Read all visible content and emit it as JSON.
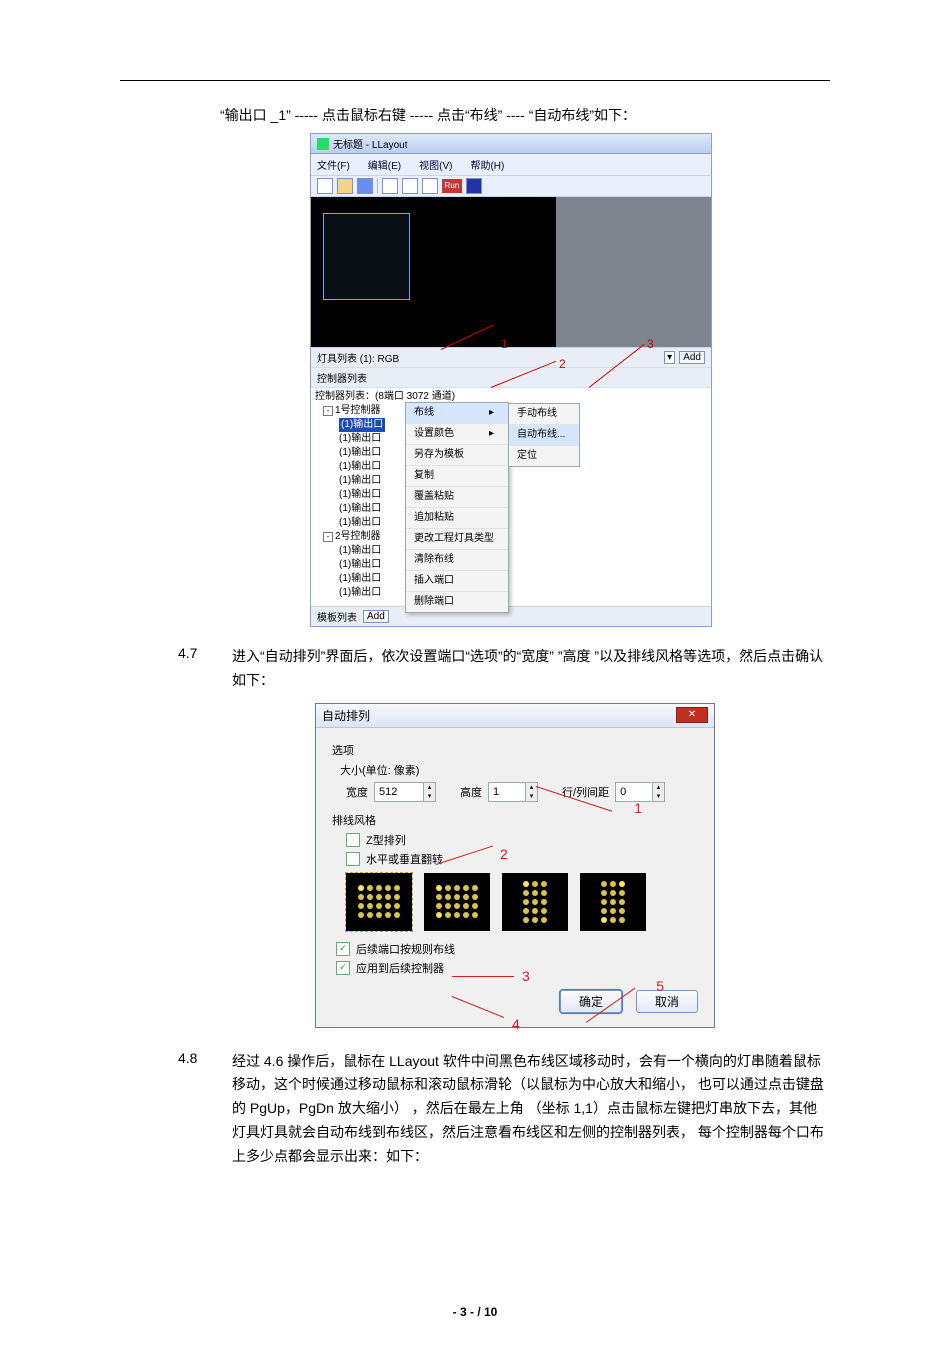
{
  "intro_line": "“输出口 _1” ----- 点击鼠标右键  -----  点击“布线”   ----  “自动布线”如下：",
  "shot1": {
    "title": "无标题 - LLayout",
    "menu": [
      "文件(F)",
      "编辑(E)",
      "视图(V)",
      "帮助(H)"
    ],
    "toolbar_run": "Run",
    "lamp_list_label": "灯具列表 (1): RGB",
    "add": "Add",
    "controller_list_label": "控制器列表",
    "tree_header": "控制器列表：(8端口 3072 通道)",
    "ctrl1": "1号控制器",
    "ctrl2": "2号控制器",
    "ports": [
      "(1)输出口",
      "(1)输出口",
      "(1)输出口",
      "(1)输出口",
      "(1)输出口",
      "(1)输出口",
      "(1)输出口",
      "(1)输出口"
    ],
    "ports2": [
      "(1)输出口",
      "(1)输出口",
      "(1)输出口",
      "(1)输出口"
    ],
    "template_list": "模板列表",
    "ctx_items": [
      "布线",
      "设置颜色",
      "另存为模板",
      "复制",
      "覆盖粘贴",
      "追加粘贴",
      "更改工程灯具类型",
      "清除布线",
      "插入端口",
      "删除端口"
    ],
    "ctx_sub": [
      "手动布线",
      "自动布线...",
      "定位"
    ],
    "marks": {
      "m1": "1",
      "m2": "2",
      "m3": "3"
    }
  },
  "sec47_no": "4.7",
  "sec47_body": "进入“自动排列”界面后，依次设置端口“选项”的“宽度”      ”高度 ”以及排线风格等选项，然后点击确认如下：",
  "shot2": {
    "title": "自动排列",
    "opt_label": "选项",
    "size_label": "大小(单位: 像素)",
    "width_label": "宽度",
    "width_value": "512",
    "height_label": "高度",
    "height_value": "1",
    "gap_label": "行/列间距",
    "gap_value": "0",
    "style_label": "排线风格",
    "chk_z": "Z型排列",
    "chk_hv": "水平或垂直翻转",
    "chk_follow_port": "后续端口按规则布线",
    "chk_apply_ctrl": "应用到后续控制器",
    "ok": "确定",
    "cancel": "取消",
    "marks": {
      "m1": "1",
      "m2": "2",
      "m3": "3",
      "m4": "4",
      "m5": "5"
    }
  },
  "sec48_no": "4.8",
  "sec48_body": "经过 4.6 操作后，鼠标在   LLayout  软件中间黑色布线区域移动时，会有一个横向的灯串随着鼠标移动，这个时候通过移动鼠标和滚动鼠标滑轮（以鼠标为中心放大和缩小，  也可以通过点击键盘的     PgUp，PgDn 放大缩小） ，然后在最左上角  （坐标 1,1）点击鼠标左键把灯串放下去，其他灯具灯具就会自动布线到布线区，然后注意看布线区和左侧的控制器列表，    每个控制器每个口布上多少点都会显示出来：如下：",
  "footer": "- 3 - / 10"
}
